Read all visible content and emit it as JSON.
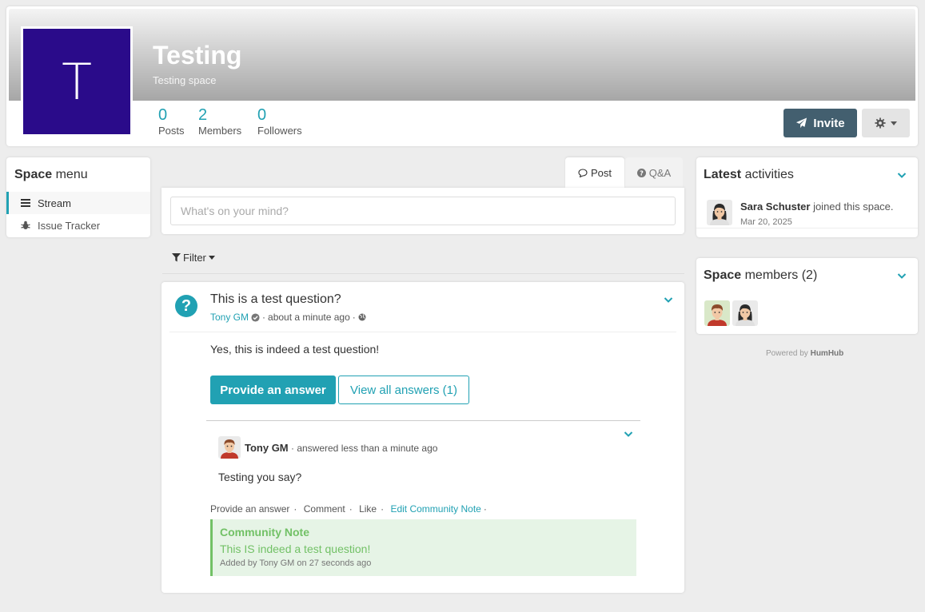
{
  "header": {
    "logo_letter": "T",
    "title": "Testing",
    "subtitle": "Testing space",
    "stats": [
      {
        "value": "0",
        "label": "Posts"
      },
      {
        "value": "2",
        "label": "Members"
      },
      {
        "value": "0",
        "label": "Followers"
      }
    ],
    "invite_label": "Invite",
    "colors": {
      "logo_bg": "#2a0b8a",
      "accent": "#21a1b3",
      "invite_bg": "#435f6f"
    }
  },
  "space_menu": {
    "title_bold": "Space",
    "title_rest": "menu",
    "items": [
      {
        "label": "Stream",
        "icon": "bars-icon",
        "active": true
      },
      {
        "label": "Issue Tracker",
        "icon": "bug-icon",
        "active": false
      }
    ]
  },
  "composer": {
    "tabs": [
      {
        "label": "Post",
        "icon": "comment-icon"
      },
      {
        "label": "Q&A",
        "icon": "question-circle-icon"
      }
    ],
    "placeholder": "What's on your mind?",
    "filter_label": "Filter"
  },
  "post": {
    "title": "This is a test question?",
    "author": "Tony GM",
    "time": "about a minute ago",
    "body": "Yes, this is indeed a test question!",
    "provide_answer_label": "Provide an answer",
    "view_all_label": "View all answers (1)",
    "answer": {
      "author": "Tony GM",
      "meta": "answered less than a minute ago",
      "body": "Testing you say?"
    },
    "actions": [
      "Provide an answer",
      "Comment",
      "Like",
      "Edit Community Note"
    ],
    "community_note": {
      "title": "Community Note",
      "text": "This IS indeed a test question!",
      "footer": "Added by Tony GM on 27 seconds ago"
    }
  },
  "activities": {
    "title_bold": "Latest",
    "title_rest": "activities",
    "item": {
      "user": "Sara Schuster",
      "text": "joined this space.",
      "date": "Mar 20, 2025"
    }
  },
  "members": {
    "title_bold": "Space",
    "title_rest": "members (2)"
  },
  "footer": {
    "powered_prefix": "Powered by",
    "powered_brand": "HumHub"
  }
}
